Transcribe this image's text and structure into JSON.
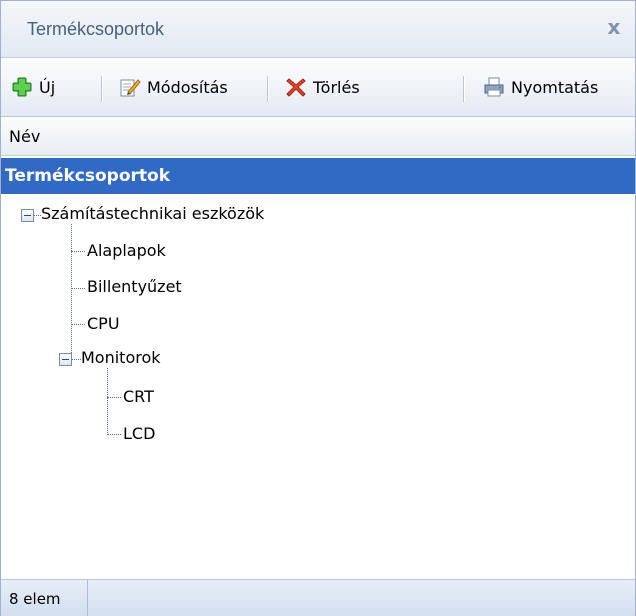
{
  "window": {
    "title": "Termékcsoportok",
    "close_label": "x"
  },
  "toolbar": {
    "new_label": "Új",
    "edit_label": "Módosítás",
    "delete_label": "Törlés",
    "print_label": "Nyomtatás"
  },
  "column": {
    "name_header": "Név"
  },
  "tree": {
    "root": "Termékcsoportok",
    "items": [
      {
        "label": "Számítástechnikai eszközök"
      },
      {
        "label": "Alaplapok"
      },
      {
        "label": "Billentyűzet"
      },
      {
        "label": "CPU"
      },
      {
        "label": "Monitorok"
      },
      {
        "label": "CRT"
      },
      {
        "label": "LCD"
      }
    ]
  },
  "status": {
    "count_text": "8 elem"
  },
  "colors": {
    "selection": "#316ac5",
    "accent": "#4a5f7b"
  },
  "icons": [
    "plus-icon",
    "edit-icon",
    "delete-icon",
    "print-icon",
    "close-icon"
  ]
}
